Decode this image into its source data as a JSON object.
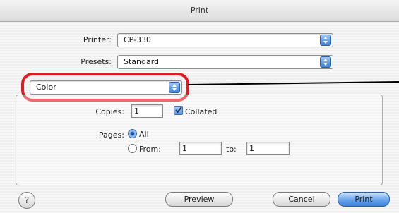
{
  "window": {
    "title": "Print"
  },
  "printer": {
    "label": "Printer:",
    "value": "CP-330"
  },
  "presets": {
    "label": "Presets:",
    "value": "Standard"
  },
  "panel": {
    "value": "Color",
    "highlight_color": "#e11b22"
  },
  "copies": {
    "label": "Copies:",
    "value": "1",
    "collated_label": "Collated",
    "collated_checked": true
  },
  "pages": {
    "label": "Pages:",
    "all_label": "All",
    "from_label": "From:",
    "from_value": "1",
    "to_label": "to:",
    "to_value": "1",
    "selected": "All"
  },
  "buttons": {
    "help": "?",
    "preview": "Preview",
    "cancel": "Cancel",
    "print": "Print"
  },
  "colors": {
    "accent": "#3d82db",
    "stripe": "#efefef"
  }
}
